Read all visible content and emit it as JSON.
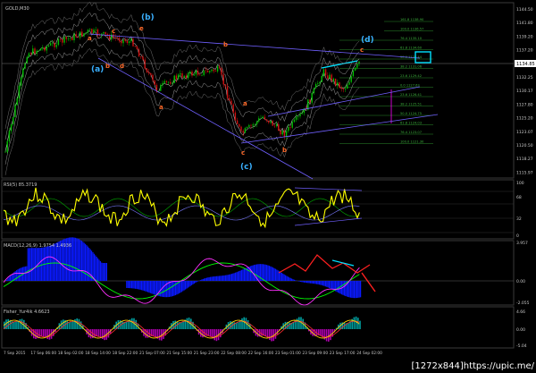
{
  "window": {
    "title": "GOLD,M30"
  },
  "watermark": "[1272x844]https://upic.me/",
  "colors": {
    "background": "#000000",
    "bull": "#00c000",
    "bear": "#d01010",
    "wave_orange": "#ff6a2a",
    "wave_blue": "#3ab0ff",
    "trend": "#7060ff",
    "fib": "#2a8a2a",
    "rsi": "#ffff00",
    "rsi_band": "#00b000",
    "macd_hist": "#0a1aff",
    "macd_main": "#ff30ff",
    "macd_signal": "#00ff00",
    "fisher_up": "#00a0a0",
    "fisher_down": "#b000b0",
    "fisher_line": "#ffd000",
    "highlight": "#00e0ff"
  },
  "main_chart": {
    "label": "GOLD,M30",
    "current_price": "1134.85",
    "price_ticks": [
      "1144.50",
      "1141.80",
      "1139.20",
      "1137.20",
      "1134.85",
      "1132.25",
      "1130.17",
      "1127.80",
      "1125.20",
      "1123.07",
      "1120.50",
      "1118.27",
      "1115.97"
    ],
    "wave_labels": [
      {
        "text": "(a)",
        "style": "blue"
      },
      {
        "text": "(b)",
        "style": "blue"
      },
      {
        "text": "(c)",
        "style": "blue"
      },
      {
        "text": "(d)",
        "style": "blue"
      },
      {
        "text": "a",
        "style": "orange"
      },
      {
        "text": "b",
        "style": "orange"
      },
      {
        "text": "c",
        "style": "orange"
      },
      {
        "text": "d",
        "style": "orange"
      },
      {
        "text": "e",
        "style": "orange"
      },
      {
        "text": "a",
        "style": "orange"
      },
      {
        "text": "b",
        "style": "orange"
      },
      {
        "text": "c",
        "style": "orange"
      },
      {
        "text": "a",
        "style": "orange"
      },
      {
        "text": "b",
        "style": "orange"
      },
      {
        "text": "c",
        "style": "orange"
      }
    ],
    "fib_levels": [
      "161.8 1138.90",
      "100.0 1136.57",
      "76.4 1135.10",
      "61.8 1134.60",
      "50.0 1133.44",
      "38.2 1131.06",
      "23.6 1129.42",
      "0.0 1127.63",
      "23.6 1126.41",
      "38.2 1125.51",
      "50.0 1124.75",
      "61.8 1124.03",
      "76.4 1123.07",
      "100.0 1121.30"
    ]
  },
  "rsi_panel": {
    "label": "RSI(5) 85.3719",
    "ticks": [
      "100",
      "68",
      "32",
      "0"
    ]
  },
  "macd_panel": {
    "label": "MACD(12,26,9) 1.9754 1.4936",
    "ticks": [
      "3.957",
      "0.00",
      "-2.055"
    ]
  },
  "fisher_panel": {
    "label": "Fisher_Yur4ik 4.6623",
    "ticks": [
      "4.66",
      "0.00",
      "-5.04"
    ]
  },
  "time_axis": [
    "7 Sep 2015",
    "17 Sep 06:00",
    "18 Sep 02:00",
    "18 Sep 14:00",
    "18 Sep 22:00",
    "21 Sep 07:00",
    "21 Sep 15:00",
    "21 Sep 23:00",
    "22 Sep 08:00",
    "22 Sep 16:00",
    "23 Sep 01:00",
    "23 Sep 09:00",
    "23 Sep 17:00",
    "24 Sep 02:00"
  ]
}
